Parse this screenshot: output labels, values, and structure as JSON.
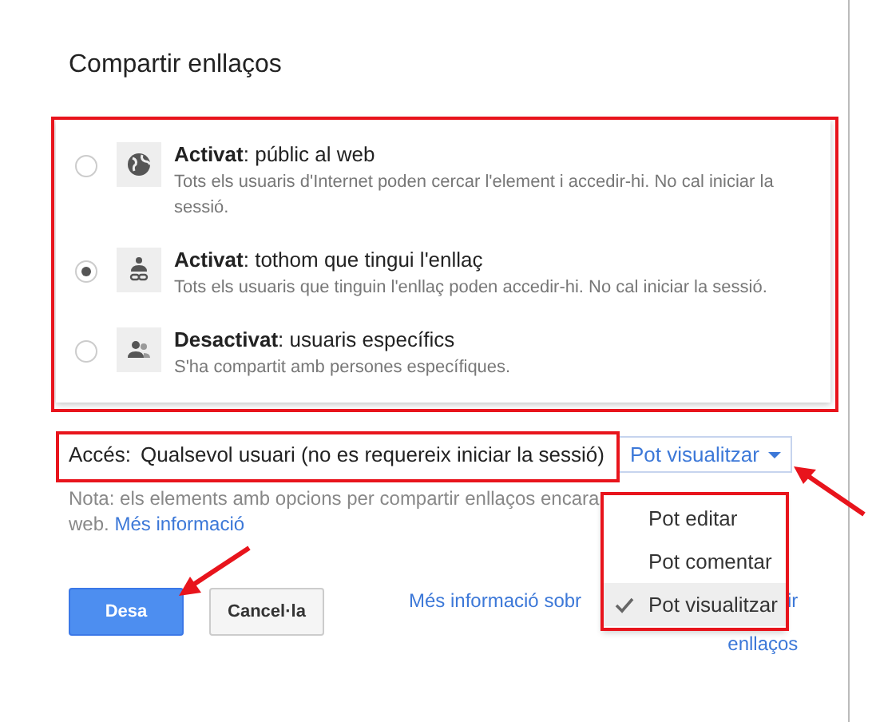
{
  "dialog": {
    "title": "Compartir enllaços"
  },
  "options": [
    {
      "label": "**Activat**: públic al web",
      "description": "Tots els usuaris d'Internet poden cercar l'element i accedir-hi. No cal iniciar la sessió.",
      "selected": false
    },
    {
      "label": "**Activat**: tothom que tingui l'enllaç",
      "description": "Tots els usuaris que tinguin l'enllaç poden accedir-hi. No cal iniciar la sessió.",
      "selected": true
    },
    {
      "label": "**Desactivat**: usuaris específics",
      "description": "S'ha compartit amb persones específiques.",
      "selected": false
    }
  ],
  "access": {
    "label": "Accés:",
    "value": "Qualsevol usuari (no es requereix iniciar la sessió)"
  },
  "permission_dropdown": {
    "value": "Pot visualitzar"
  },
  "note": {
    "line_1": "Nota: els elements amb opcions per compartir enllaços encara",
    "line_2": "web.",
    "link": "Més informació"
  },
  "buttons": [
    {
      "label": "Desa",
      "kind": "primary"
    },
    {
      "label": "Cancel·la",
      "kind": "secondary"
    }
  ],
  "help_link": {
    "line_1": "Més informació sobr",
    "line_1_end": "ir",
    "line_2": "enllaços"
  },
  "menu": {
    "items": [
      {
        "label": "Pot editar",
        "selected": false
      },
      {
        "label": "Pot comentar",
        "selected": false
      },
      {
        "label": "Pot visualitzar",
        "selected": true
      }
    ]
  }
}
